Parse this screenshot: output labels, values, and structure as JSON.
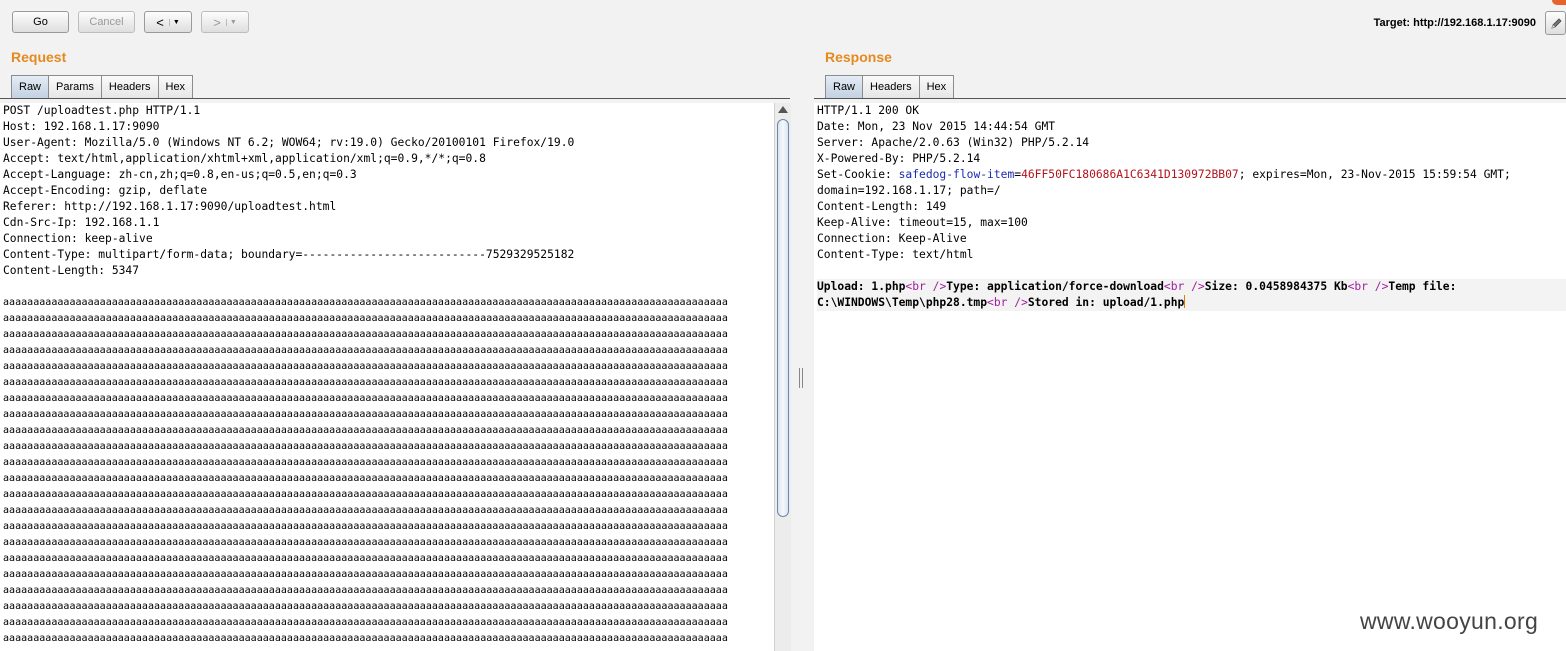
{
  "toolbar": {
    "go_label": "Go",
    "cancel_label": "Cancel",
    "back_label": "<",
    "forward_label": ">",
    "menu_glyph": "▼",
    "target_label": "Target: http://192.168.1.17:9090",
    "edit_icon": "pencil-icon"
  },
  "request": {
    "title": "Request",
    "tabs": [
      "Raw",
      "Params",
      "Headers",
      "Hex"
    ],
    "active_tab": "Raw",
    "lines": [
      "POST /uploadtest.php HTTP/1.1",
      "Host: 192.168.1.17:9090",
      "User-Agent: Mozilla/5.0 (Windows NT 6.2; WOW64; rv:19.0) Gecko/20100101 Firefox/19.0",
      "Accept: text/html,application/xhtml+xml,application/xml;q=0.9,*/*;q=0.8",
      "Accept-Language: zh-cn,zh;q=0.8,en-us;q=0.5,en;q=0.3",
      "Accept-Encoding: gzip, deflate",
      "Referer: http://192.168.1.17:9090/uploadtest.html",
      "Cdn-Src-Ip: 192.168.1.1",
      "Connection: keep-alive",
      "Content-Type: multipart/form-data; boundary=---------------------------7529329525182",
      "Content-Length: 5347"
    ],
    "body_line": "aaaaaaaaaaaaaaaaaaaaaaaaaaaaaaaaaaaaaaaaaaaaaaaaaaaaaaaaaaaaaaaaaaaaaaaaaaaaaaaaaaaaaaaaaaaaaaaaaaaaaaaaaaaaaaaaaaaaaaaa",
    "body_line_count": 22
  },
  "response": {
    "title": "Response",
    "tabs": [
      "Raw",
      "Headers",
      "Hex"
    ],
    "active_tab": "Raw",
    "lines": [
      "HTTP/1.1 200 OK",
      "Date: Mon, 23 Nov 2015 14:44:54 GMT",
      "Server: Apache/2.0.63 (Win32) PHP/5.2.14",
      "X-Powered-By: PHP/5.2.14"
    ],
    "cookie": {
      "prefix": "Set-Cookie: ",
      "name": "safedog-flow-item",
      "eq": "=",
      "value": "46FF50FC180686A1C6341D130972BB07",
      "rest": "; expires=Mon, 23-Nov-2015 15:59:54 GMT;",
      "line2": "domain=192.168.1.17; path=/"
    },
    "lines_after": [
      "Content-Length: 149",
      "Keep-Alive: timeout=15, max=100",
      "Connection: Keep-Alive",
      "Content-Type: text/html"
    ],
    "body": {
      "t1": "Upload: 1.php",
      "br": "<br />",
      "br_open": "<",
      "br_tag": "br",
      "br_close": " />",
      "t2": "Type: application/force-download",
      "t3": "Size: 0.0458984375 Kb",
      "t4": "Temp file: ",
      "t5": "C:\\WINDOWS\\Temp\\php28.tmp",
      "t6": "Stored in: upload/1.php"
    }
  },
  "watermark": "www.wooyun.org"
}
